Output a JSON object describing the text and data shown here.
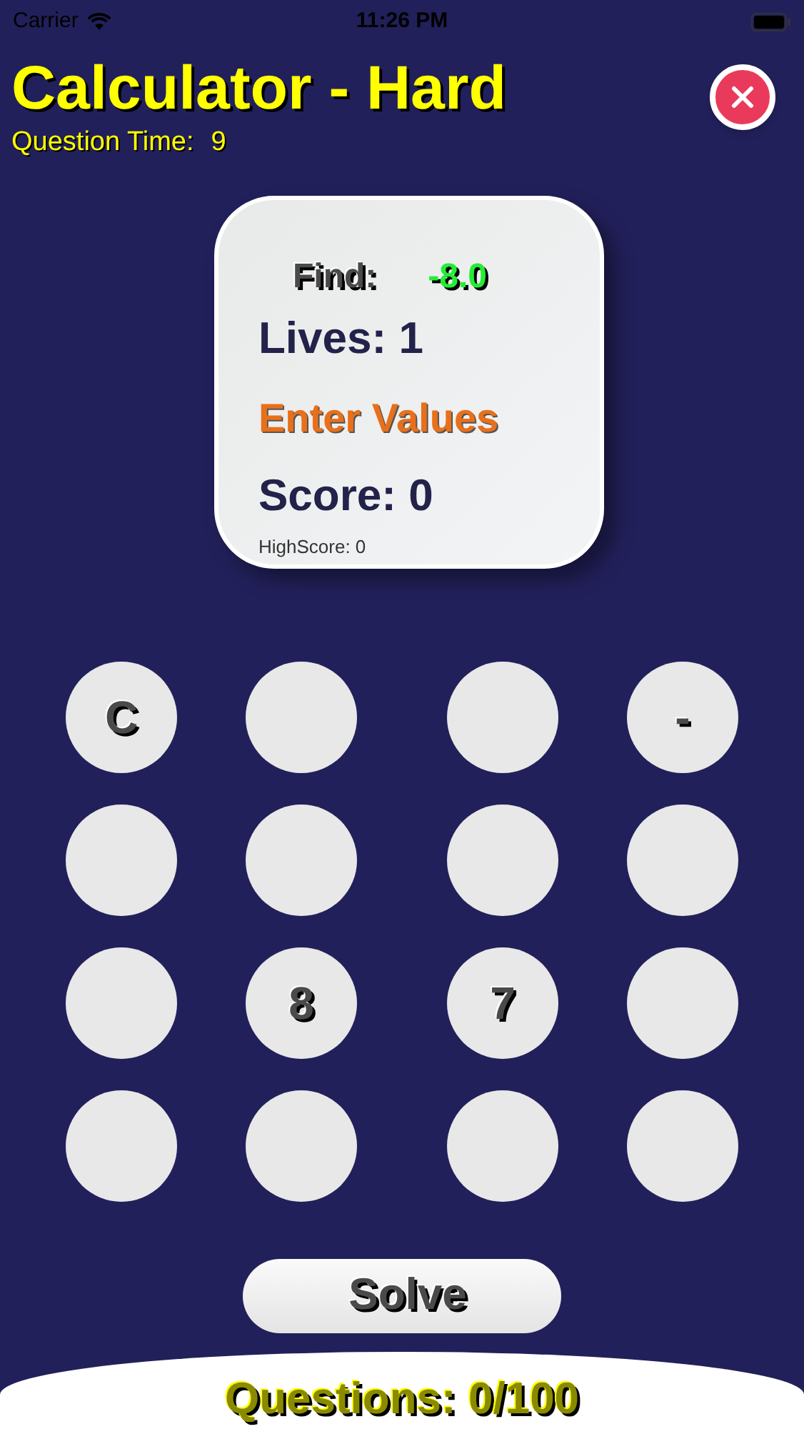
{
  "status_bar": {
    "carrier": "Carrier",
    "time": "11:26 PM"
  },
  "header": {
    "title": "Calculator - Hard",
    "question_time_label": "Question Time:",
    "question_time": "9"
  },
  "card": {
    "find_label": "Find:",
    "find_value": "-8.0",
    "lives": "Lives: 1",
    "message": "Enter Values",
    "score": "Score: 0",
    "high_score": "HighScore: 0"
  },
  "keys": [
    {
      "kind": "label",
      "label": "C"
    },
    {
      "kind": "blank"
    },
    {
      "kind": "blank"
    },
    {
      "kind": "label",
      "label": "-"
    },
    {
      "kind": "blank"
    },
    {
      "kind": "blank"
    },
    {
      "kind": "blank"
    },
    {
      "kind": "blank"
    },
    {
      "kind": "blank"
    },
    {
      "kind": "label",
      "label": "8"
    },
    {
      "kind": "label",
      "label": "7"
    },
    {
      "kind": "blank"
    },
    {
      "kind": "blank"
    },
    {
      "kind": "blank"
    },
    {
      "kind": "blank"
    },
    {
      "kind": "blank"
    }
  ],
  "solve_button": "Solve",
  "footer": {
    "questions": "Questions: 0/100"
  }
}
